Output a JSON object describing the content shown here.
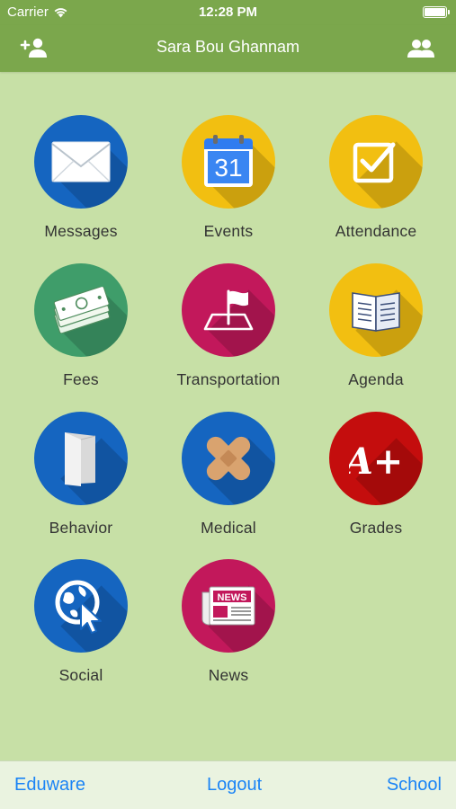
{
  "status_bar": {
    "carrier": "Carrier",
    "time": "12:28 PM"
  },
  "nav": {
    "title": "Sara Bou Ghannam",
    "left_icon": "add-user-icon",
    "right_icon": "users-icon"
  },
  "tiles": [
    {
      "label": "Messages",
      "icon": "envelope-icon",
      "color": "#1565c0"
    },
    {
      "label": "Events",
      "icon": "calendar-icon",
      "color": "#f2bf11",
      "calendar_day": "31"
    },
    {
      "label": "Attendance",
      "icon": "checkbox-icon",
      "color": "#f2bf11"
    },
    {
      "label": "Fees",
      "icon": "money-icon",
      "color": "#3f9d6a"
    },
    {
      "label": "Transportation",
      "icon": "flag-icon",
      "color": "#c2185b"
    },
    {
      "label": "Agenda",
      "icon": "book-icon",
      "color": "#f2bf11"
    },
    {
      "label": "Behavior",
      "icon": "door-icon",
      "color": "#1565c0"
    },
    {
      "label": "Medical",
      "icon": "bandage-icon",
      "color": "#1565c0"
    },
    {
      "label": "Grades",
      "icon": "grade-icon",
      "color": "#c40d0d",
      "grade_text": "A+"
    },
    {
      "label": "Social",
      "icon": "globe-cursor-icon",
      "color": "#1565c0"
    },
    {
      "label": "News",
      "icon": "newspaper-icon",
      "color": "#c2185b",
      "news_text": "NEWS"
    }
  ],
  "tab_bar": {
    "left": "Eduware",
    "center": "Logout",
    "right": "School"
  },
  "colors": {
    "nav_green": "#7ba74c",
    "background": "#c7e0a6",
    "link_blue": "#1b84f5"
  }
}
